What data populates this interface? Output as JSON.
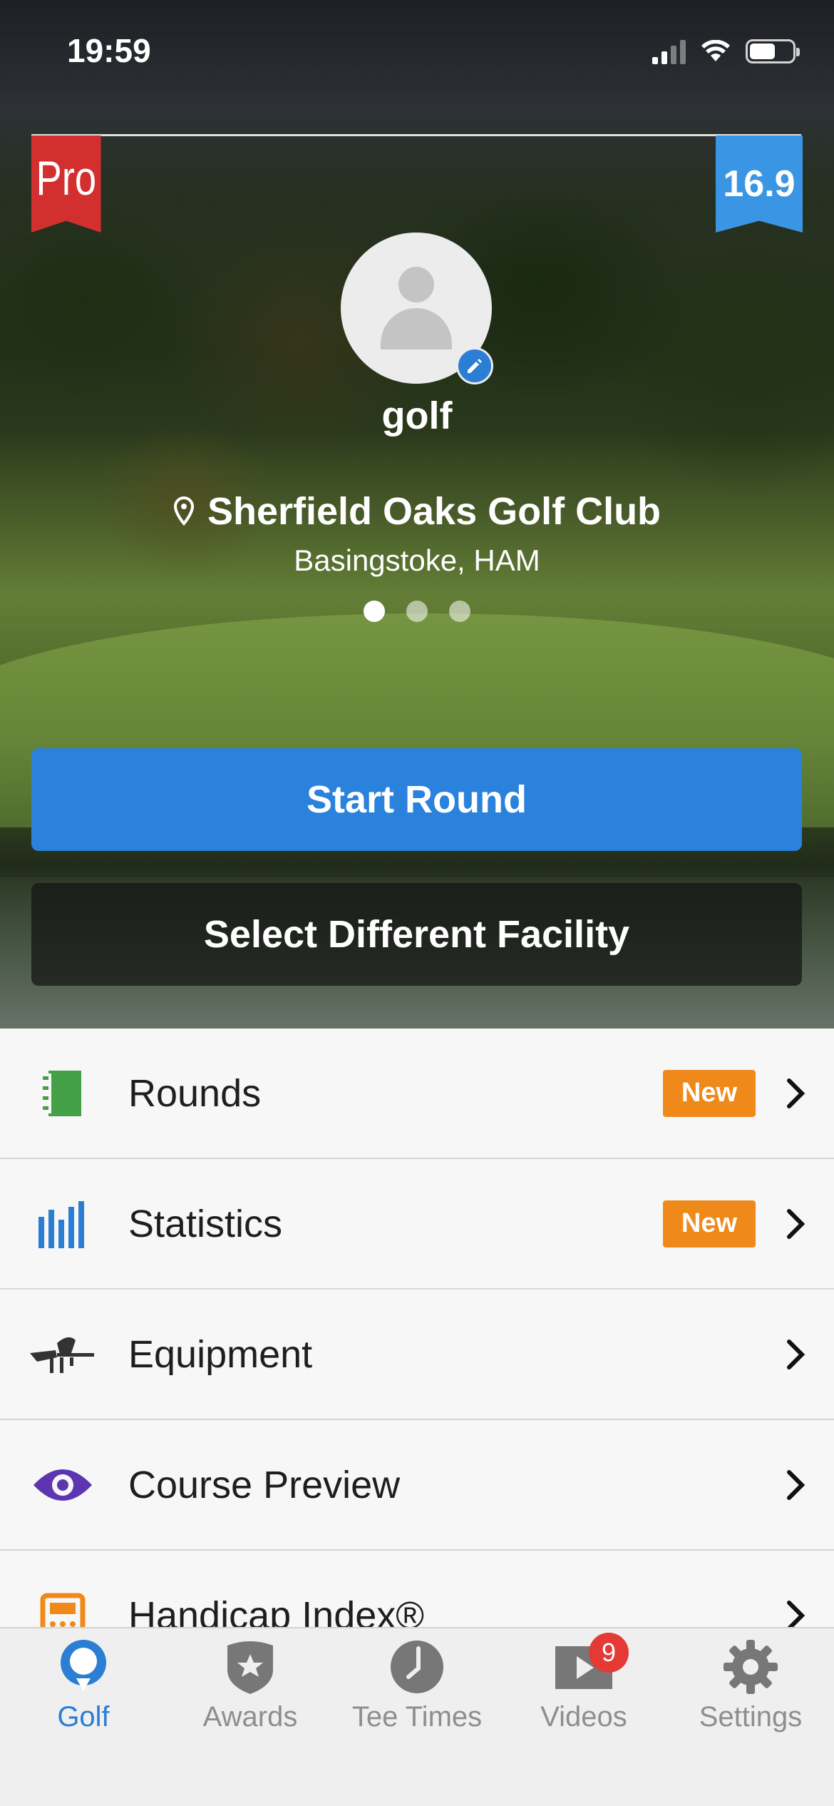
{
  "status_bar": {
    "time": "19:59"
  },
  "profile": {
    "membership": "Pro",
    "handicap": "16.9",
    "username": "golf"
  },
  "facility": {
    "name": "Sherfield Oaks Golf Club",
    "location": "Basingstoke, HAM",
    "page_count": 3,
    "active_page": 1
  },
  "actions": {
    "start_label": "Start Round",
    "select_label": "Select Different Facility"
  },
  "menu": {
    "items": [
      {
        "label": "Rounds",
        "badge": "New",
        "icon": "scorecard-icon",
        "icon_color": "#43a047"
      },
      {
        "label": "Statistics",
        "badge": "New",
        "icon": "bar-chart-icon",
        "icon_color": "#2a7ed3"
      },
      {
        "label": "Equipment",
        "icon": "golf-clubs-icon",
        "icon_color": "#333333"
      },
      {
        "label": "Course Preview",
        "icon": "eye-icon",
        "icon_color": "#5e35b1"
      },
      {
        "label": "Handicap Index®",
        "icon": "handicap-card-icon",
        "icon_color": "#ef8a1a"
      }
    ]
  },
  "tabbar": {
    "tabs": [
      {
        "label": "Golf",
        "icon": "golf-ball-tee-icon",
        "active": true
      },
      {
        "label": "Awards",
        "icon": "shield-star-icon"
      },
      {
        "label": "Tee Times",
        "icon": "clock-icon"
      },
      {
        "label": "Videos",
        "icon": "video-play-icon",
        "badge": "9"
      },
      {
        "label": "Settings",
        "icon": "gear-icon"
      }
    ]
  },
  "colors": {
    "primary_blue": "#2a82dc",
    "pro_red": "#d32f2f",
    "handicap_blue": "#3a96e4",
    "new_badge_orange": "#ef8a1a",
    "notification_red": "#e53935"
  }
}
